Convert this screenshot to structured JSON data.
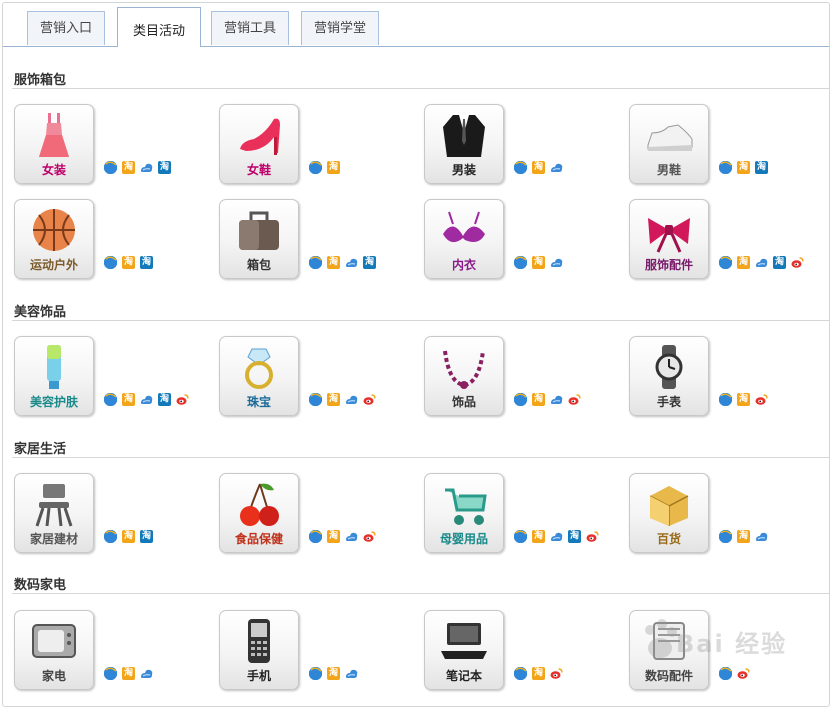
{
  "tabs": [
    {
      "label": "营销入口",
      "active": false
    },
    {
      "label": "类目活动",
      "active": true
    },
    {
      "label": "营销工具",
      "active": false
    },
    {
      "label": "营销学堂",
      "active": false
    }
  ],
  "sections": [
    {
      "title": "服饰箱包",
      "items": [
        {
          "label": "女装",
          "label_color": "#c0006a",
          "icon": "dress-icon",
          "channels": [
            "ie",
            "taobao-orange",
            "cloud",
            "taobao-blue"
          ]
        },
        {
          "label": "女鞋",
          "label_color": "#c0006a",
          "icon": "high-heel-icon",
          "channels": [
            "ie",
            "taobao-orange"
          ]
        },
        {
          "label": "男装",
          "label_color": "#222222",
          "icon": "suit-icon",
          "channels": [
            "ie",
            "taobao-orange",
            "cloud"
          ]
        },
        {
          "label": "男鞋",
          "label_color": "#555555",
          "icon": "sneaker-icon",
          "channels": [
            "ie",
            "taobao-orange",
            "taobao-blue"
          ]
        },
        {
          "label": "运动户外",
          "label_color": "#7a5a2a",
          "icon": "basketball-icon",
          "channels": [
            "ie",
            "taobao-orange",
            "taobao-blue"
          ]
        },
        {
          "label": "箱包",
          "label_color": "#333333",
          "icon": "bag-icon",
          "channels": [
            "ie",
            "taobao-orange",
            "cloud",
            "taobao-blue"
          ]
        },
        {
          "label": "内衣",
          "label_color": "#8a1a8a",
          "icon": "bra-icon",
          "channels": [
            "ie",
            "taobao-orange",
            "cloud"
          ]
        },
        {
          "label": "服饰配件",
          "label_color": "#7a1a6a",
          "icon": "bow-icon",
          "channels": [
            "ie",
            "taobao-orange",
            "cloud",
            "taobao-blue",
            "weibo"
          ]
        }
      ]
    },
    {
      "title": "美容饰品",
      "items": [
        {
          "label": "美容护肤",
          "label_color": "#1a8a8a",
          "icon": "lotion-tube-icon",
          "channels": [
            "ie",
            "taobao-orange",
            "cloud",
            "taobao-blue",
            "weibo"
          ]
        },
        {
          "label": "珠宝",
          "label_color": "#1a6a9a",
          "icon": "ring-icon",
          "channels": [
            "ie",
            "taobao-orange",
            "cloud",
            "weibo"
          ]
        },
        {
          "label": "饰品",
          "label_color": "#333333",
          "icon": "necklace-icon",
          "channels": [
            "ie",
            "taobao-orange",
            "cloud",
            "weibo"
          ]
        },
        {
          "label": "手表",
          "label_color": "#333333",
          "icon": "watch-icon",
          "channels": [
            "ie",
            "taobao-orange",
            "weibo"
          ]
        }
      ]
    },
    {
      "title": "家居生活",
      "items": [
        {
          "label": "家居建材",
          "label_color": "#555555",
          "icon": "chair-icon",
          "channels": [
            "ie",
            "taobao-orange",
            "taobao-blue"
          ]
        },
        {
          "label": "食品保健",
          "label_color": "#c0301a",
          "icon": "cherry-icon",
          "channels": [
            "ie",
            "taobao-orange",
            "cloud",
            "weibo"
          ]
        },
        {
          "label": "母婴用品",
          "label_color": "#1a8a8a",
          "icon": "stroller-icon",
          "channels": [
            "ie",
            "taobao-orange",
            "cloud",
            "taobao-blue",
            "weibo"
          ]
        },
        {
          "label": "百货",
          "label_color": "#9a6a1a",
          "icon": "box-icon",
          "channels": [
            "ie",
            "taobao-orange",
            "cloud"
          ]
        }
      ]
    },
    {
      "title": "数码家电",
      "items": [
        {
          "label": "家电",
          "label_color": "#444444",
          "icon": "tv-icon",
          "channels": [
            "ie",
            "taobao-orange",
            "cloud"
          ]
        },
        {
          "label": "手机",
          "label_color": "#222222",
          "icon": "phone-icon",
          "channels": [
            "ie",
            "taobao-orange",
            "cloud"
          ]
        },
        {
          "label": "笔记本",
          "label_color": "#222222",
          "icon": "laptop-icon",
          "channels": [
            "ie",
            "taobao-orange",
            "weibo"
          ]
        },
        {
          "label": "数码配件",
          "label_color": "#444444",
          "icon": "digital-accessory-icon",
          "channels": [
            "ie",
            "weibo"
          ]
        }
      ]
    }
  ],
  "channel_icon_text": {
    "taobao": "淘"
  },
  "watermark": {
    "text": "Bai 经验"
  }
}
